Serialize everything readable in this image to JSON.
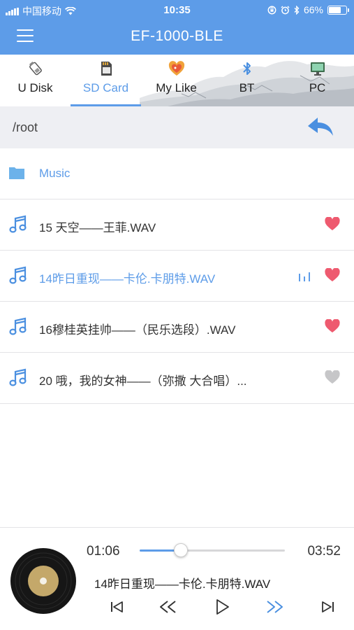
{
  "status_bar": {
    "carrier": "中国移动",
    "time": "10:35",
    "battery": "66%",
    "battery_level": 0.66
  },
  "header": {
    "title": "EF-1000-BLE"
  },
  "tabs": [
    {
      "label": "U Disk",
      "icon": "usb-drive-icon"
    },
    {
      "label": "SD Card",
      "icon": "sd-card-icon",
      "active": true
    },
    {
      "label": "My Like",
      "icon": "heart-badge-icon"
    },
    {
      "label": "BT",
      "icon": "bluetooth-icon"
    },
    {
      "label": "PC",
      "icon": "monitor-icon"
    }
  ],
  "path": {
    "current": "/root"
  },
  "list": {
    "folder": {
      "name": "Music",
      "icon": "folder-icon"
    },
    "songs": [
      {
        "title": "15 天空——王菲.WAV",
        "liked": true,
        "playing": false
      },
      {
        "title": "14昨日重现——卡伦.卡朋特.WAV",
        "liked": true,
        "playing": true
      },
      {
        "title": "16穆桂英挂帅——（民乐选段）.WAV",
        "liked": true,
        "playing": false
      },
      {
        "title": "20  哦，我的女神——（弥撒 大合唱）...",
        "liked": false,
        "playing": false
      }
    ]
  },
  "player": {
    "current_time": "01:06",
    "total_time": "03:52",
    "progress": 0.284,
    "now_playing": "14昨日重现——卡伦.卡朋特.WAV"
  },
  "colors": {
    "accent": "#5d9ce8",
    "heart_on": "#ee5a6f",
    "heart_off": "#c6c6c8"
  }
}
